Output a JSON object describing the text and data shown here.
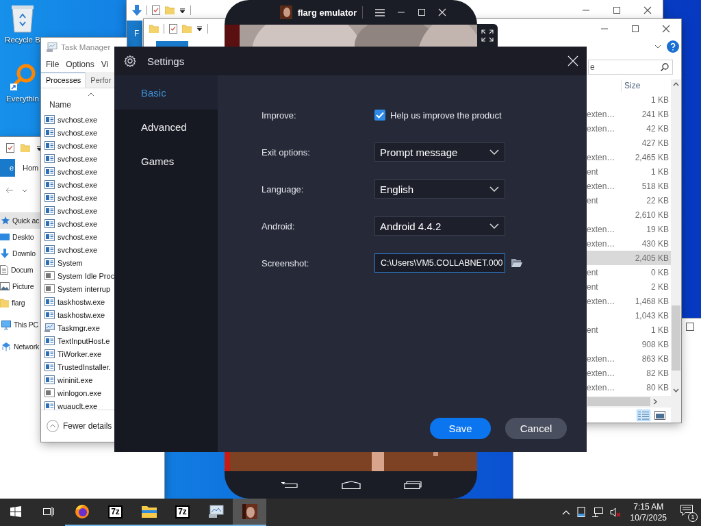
{
  "desktop_icons": [
    {
      "label": "Recycle B",
      "kind": "recycle-bin"
    },
    {
      "label": "Everythin",
      "kind": "magnifier"
    }
  ],
  "explorer_back": {
    "ribbon_tab": "F"
  },
  "explorer_front": {
    "search": {
      "placeholder": "e"
    },
    "column": "Size",
    "rows": [
      {
        "size": "1 KB",
        "selected": false
      },
      {
        "type": "exten…",
        "size": "241 KB",
        "selected": false
      },
      {
        "type": "exten…",
        "size": "42 KB",
        "selected": false
      },
      {
        "size": "427 KB",
        "selected": false
      },
      {
        "type": "exten…",
        "size": "2,465 KB",
        "selected": false
      },
      {
        "type": "ent",
        "size": "1 KB",
        "selected": false
      },
      {
        "type": "exten…",
        "size": "518 KB",
        "selected": false
      },
      {
        "type": "ent",
        "size": "22 KB",
        "selected": false
      },
      {
        "size": "2,610 KB",
        "selected": false
      },
      {
        "type": "exten…",
        "size": "19 KB",
        "selected": false
      },
      {
        "type": "exten…",
        "size": "430 KB",
        "selected": false
      },
      {
        "size": "2,405 KB",
        "selected": true
      },
      {
        "type": "ent",
        "size": "0 KB",
        "selected": false
      },
      {
        "type": "ent",
        "size": "2 KB",
        "selected": false
      },
      {
        "type": "exten…",
        "size": "1,468 KB",
        "selected": false
      },
      {
        "size": "1,043 KB",
        "selected": false
      },
      {
        "type": "ent",
        "size": "1 KB",
        "selected": false
      },
      {
        "size": "908 KB",
        "selected": false
      },
      {
        "type": "exten…",
        "size": "863 KB",
        "selected": false
      },
      {
        "type": "exten…",
        "size": "82 KB",
        "selected": false
      },
      {
        "type": "exten…",
        "size": "80 KB",
        "selected": false
      }
    ]
  },
  "explorer_left": {
    "ribbon_tabs": [
      {
        "label": "e",
        "selected": true
      },
      {
        "label": "Hom",
        "selected": false
      }
    ],
    "nav_items": [
      {
        "label": "Quick ac",
        "kind": "quick",
        "selected": true
      },
      {
        "label": "Deskto",
        "kind": "desktop",
        "selected": false
      },
      {
        "label": "Downlo",
        "kind": "download",
        "selected": false
      },
      {
        "label": "Docum",
        "kind": "documents",
        "selected": false
      },
      {
        "label": "Picture",
        "kind": "pictures",
        "selected": false
      },
      {
        "label": "flarg",
        "kind": "folder",
        "selected": false
      },
      {
        "label": "This PC",
        "kind": "pc",
        "selected": false
      },
      {
        "label": "Network",
        "kind": "network",
        "selected": false
      }
    ]
  },
  "task_manager": {
    "title": "Task Manager",
    "menu": [
      "File",
      "Options",
      "Vi"
    ],
    "tabs": [
      {
        "label": "Processes",
        "selected": true
      },
      {
        "label": "Perfor",
        "selected": false
      }
    ],
    "column": "Name",
    "processes": [
      {
        "name": "svchost.exe",
        "kind": "app"
      },
      {
        "name": "svchost.exe",
        "kind": "app"
      },
      {
        "name": "svchost.exe",
        "kind": "app"
      },
      {
        "name": "svchost.exe",
        "kind": "app"
      },
      {
        "name": "svchost.exe",
        "kind": "app"
      },
      {
        "name": "svchost.exe",
        "kind": "app"
      },
      {
        "name": "svchost.exe",
        "kind": "app"
      },
      {
        "name": "svchost.exe",
        "kind": "app"
      },
      {
        "name": "svchost.exe",
        "kind": "app"
      },
      {
        "name": "svchost.exe",
        "kind": "app"
      },
      {
        "name": "svchost.exe",
        "kind": "app"
      },
      {
        "name": "System",
        "kind": "app"
      },
      {
        "name": "System Idle Proc",
        "kind": "system"
      },
      {
        "name": "System interrup",
        "kind": "system"
      },
      {
        "name": "taskhostw.exe",
        "kind": "app"
      },
      {
        "name": "taskhostw.exe",
        "kind": "app"
      },
      {
        "name": "Taskmgr.exe",
        "kind": "taskmgr"
      },
      {
        "name": "TextInputHost.e",
        "kind": "app"
      },
      {
        "name": "TiWorker.exe",
        "kind": "app"
      },
      {
        "name": "TrustedInstaller.",
        "kind": "app"
      },
      {
        "name": "wininit.exe",
        "kind": "app"
      },
      {
        "name": "winlogon.exe",
        "kind": "system"
      },
      {
        "name": "wuauclt.exe",
        "kind": "app"
      }
    ],
    "footer": "Fewer details"
  },
  "emulator": {
    "title": "flarg emulator"
  },
  "settings": {
    "title": "Settings",
    "nav": [
      {
        "label": "Basic",
        "selected": true
      },
      {
        "label": "Advanced",
        "selected": false
      },
      {
        "label": "Games",
        "selected": false
      }
    ],
    "fields": [
      {
        "label": "Improve:",
        "kind": "checkbox",
        "text": "Help us improve the product",
        "checked": true
      },
      {
        "label": "Exit options:",
        "kind": "dropdown",
        "value": "Prompt message"
      },
      {
        "label": "Language:",
        "kind": "dropdown",
        "value": "English"
      },
      {
        "label": "Android:",
        "kind": "dropdown",
        "value": "Android 4.4.2"
      },
      {
        "label": "Screenshot:",
        "kind": "path",
        "value": "C:\\Users\\VM5.COLLABNET.000"
      }
    ],
    "buttons": [
      {
        "label": "Save",
        "kind": "primary"
      },
      {
        "label": "Cancel",
        "kind": "secondary"
      }
    ]
  },
  "taskbar": {
    "buttons": [
      {
        "kind": "start",
        "running": false,
        "selected": false
      },
      {
        "kind": "task-view",
        "running": false,
        "selected": false
      },
      {
        "kind": "browser",
        "running": true,
        "selected": false
      },
      {
        "kind": "archiver",
        "icon_text": "7z",
        "running": true,
        "selected": false
      },
      {
        "kind": "folder",
        "running": true,
        "selected": false
      },
      {
        "kind": "archiver",
        "icon_text": "7z",
        "running": true,
        "selected": false
      },
      {
        "kind": "monitor",
        "running": true,
        "selected": false
      },
      {
        "kind": "emulator",
        "running": true,
        "selected": true
      }
    ],
    "tray": {
      "muted": true,
      "time": "7:15 AM",
      "date": "10/7/2025",
      "notifications": "1"
    }
  }
}
